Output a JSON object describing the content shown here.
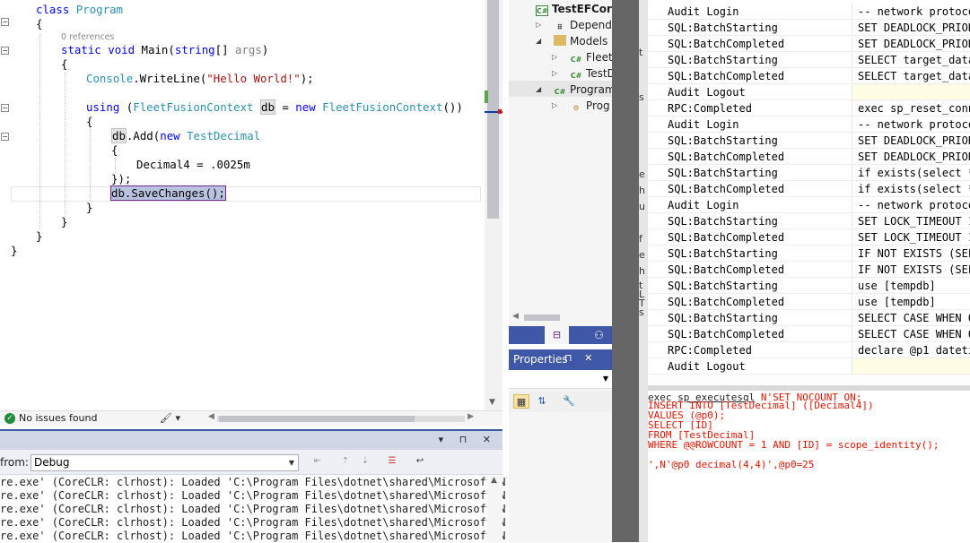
{
  "editor": {
    "codelens": "0 references",
    "lines": {
      "l1_kw": "class",
      "l1_ty": "Program",
      "l2": "{",
      "l3_kw1": "static",
      "l3_kw2": "void",
      "l3_name": "Main(",
      "l3_kw3": "string",
      "l3_rest": "[] ",
      "l3_args": "args",
      "l3_close": ")",
      "l4": "{",
      "l5_ty": "Console",
      "l5_mid": ".WriteLine(",
      "l5_str": "\"Hello World!\"",
      "l5_end": ");",
      "l6_kw": "using",
      "l6_open": " (",
      "l6_ty": "FleetFusionContext",
      "l6_sp": " ",
      "l6_db": "db",
      "l6_eq": " = ",
      "l6_new": "new",
      "l6_ty2": "FleetFusionContext",
      "l6_end": "())",
      "l7": "{",
      "l8_db": "db",
      "l8_add": ".Add(",
      "l8_new": "new",
      "l8_ty": "TestDecimal",
      "l9": "{",
      "l10": "Decimal4 = .0025m",
      "l11": "});",
      "l12_db": "db",
      "l12_rest": ".SaveChanges();",
      "l13": "}",
      "l14": "}",
      "l15": "}",
      "l16": "}"
    }
  },
  "editor_status": {
    "issues": "No issues found",
    "brush": "🖌 ▾"
  },
  "output": {
    "title_buttons": "▾ ⊓ ✕",
    "from_label": "from:",
    "source": "Debug",
    "lines": [
      "re.exe' (CoreCLR: clrhost): Loaded 'C:\\Program Files\\dotnet\\shared\\Microsoft.N",
      "re.exe' (CoreCLR: clrhost): Loaded 'C:\\Program Files\\dotnet\\shared\\Microsoft.N",
      "re.exe' (CoreCLR: clrhost): Loaded 'C:\\Program Files\\dotnet\\shared\\Microsoft.N",
      "re.exe' (CoreCLR: clrhost): Loaded 'C:\\Program Files\\dotnet\\shared\\Microsoft.N",
      "re.exe' (CoreCLR: clrhost): Loaded 'C:\\Program Files\\dotnet\\shared\\Microsoft.N"
    ]
  },
  "solution": {
    "project": "TestEFCore",
    "dependencies": "Depende",
    "models": "Models",
    "fleet": "Fleet",
    "testd": "TestD",
    "program_file": "Program",
    "program_class": "Prog"
  },
  "properties": {
    "title": "Properties",
    "buttons": "⊓ ✕"
  },
  "splitter_fragments": [
    "t",
    "s",
    "e",
    "h",
    "u",
    "f",
    "e",
    "h",
    "t",
    "L",
    "T",
    "s"
  ],
  "profiler": {
    "rows": [
      {
        "event": "Audit Login",
        "text": "-- network protoco"
      },
      {
        "event": "SQL:BatchStarting",
        "text": "SET DEADLOCK_PRIOR"
      },
      {
        "event": "SQL:BatchCompleted",
        "text": "SET DEADLOCK_PRIOR"
      },
      {
        "event": "SQL:BatchStarting",
        "text": "SELECT target_data"
      },
      {
        "event": "SQL:BatchCompleted",
        "text": "SELECT target_data"
      },
      {
        "event": "Audit Logout",
        "text": ""
      },
      {
        "event": "RPC:Completed",
        "text": "exec sp_reset_conn"
      },
      {
        "event": "Audit Login",
        "text": "-- network protoco"
      },
      {
        "event": "SQL:BatchStarting",
        "text": "SET DEADLOCK_PRIOR"
      },
      {
        "event": "SQL:BatchCompleted",
        "text": "SET DEADLOCK_PRIOR"
      },
      {
        "event": "SQL:BatchStarting",
        "text": "if exists(select *"
      },
      {
        "event": "SQL:BatchCompleted",
        "text": "if exists(select *"
      },
      {
        "event": "Audit Login",
        "text": "-- network protoco"
      },
      {
        "event": "SQL:BatchStarting",
        "text": "SET LOCK_TIMEOUT 1"
      },
      {
        "event": "SQL:BatchCompleted",
        "text": "SET LOCK_TIMEOUT 1"
      },
      {
        "event": "SQL:BatchStarting",
        "text": "IF NOT EXISTS (SEL"
      },
      {
        "event": "SQL:BatchCompleted",
        "text": "IF NOT EXISTS (SEL"
      },
      {
        "event": "SQL:BatchStarting",
        "text": "use [tempdb]"
      },
      {
        "event": "SQL:BatchCompleted",
        "text": "use [tempdb]"
      },
      {
        "event": "SQL:BatchStarting",
        "text": "SELECT CASE WHEN O"
      },
      {
        "event": "SQL:BatchCompleted",
        "text": "SELECT CASE WHEN O"
      },
      {
        "event": "RPC:Completed",
        "text": "declare @p1 dateti"
      },
      {
        "event": "Audit Logout",
        "text": ""
      }
    ]
  },
  "sql": {
    "l1_a": "exec ",
    "l1_b": "sp_executesql",
    "l1_c": " N'SET NOCOUNT ON;",
    "l2": "INSERT INTO [TestDecimal] ([Decimal4])",
    "l3": "VALUES (@p0);",
    "l4": "SELECT [ID]",
    "l5": "FROM [TestDecimal]",
    "l6": "WHERE @@ROWCOUNT = 1 AND [ID] = scope_identity();",
    "l7": "",
    "l8": "',N'@p0 decimal(4,4)',@p0=25"
  }
}
